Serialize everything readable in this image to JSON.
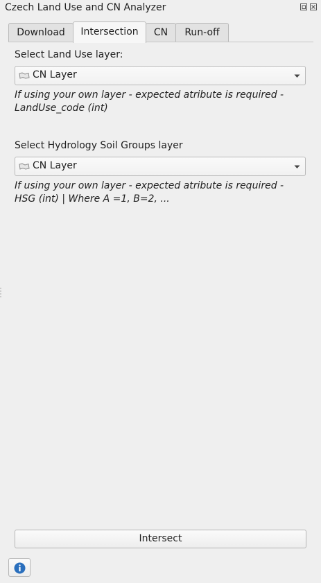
{
  "window": {
    "title": "Czech Land Use and CN Analyzer"
  },
  "tabs": [
    {
      "label": "Download",
      "active": false
    },
    {
      "label": "Intersection",
      "active": true
    },
    {
      "label": "CN",
      "active": false
    },
    {
      "label": "Run-off",
      "active": false
    }
  ],
  "land_use": {
    "label": "Select Land Use layer:",
    "selected": "CN Layer",
    "hint": "If using your own layer - expected atribute is required - LandUse_code (int)"
  },
  "hsg": {
    "label": "Select Hydrology Soil Groups layer",
    "selected": "CN Layer",
    "hint": "If using your own layer - expected atribute is required - HSG (int) | Where A =1, B=2, ..."
  },
  "actions": {
    "intersect_label": "Intersect",
    "info_icon": "info-icon"
  },
  "colors": {
    "background": "#efefef",
    "info_blue": "#2a6fbd"
  }
}
